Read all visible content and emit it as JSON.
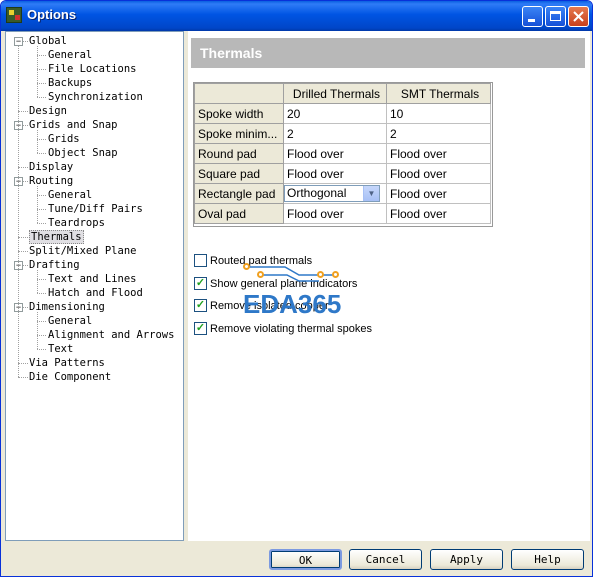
{
  "window": {
    "title": "Options",
    "app_icon_text": "PADS"
  },
  "tree": [
    {
      "label": "Global",
      "level": 0,
      "expandable": true
    },
    {
      "label": "General",
      "level": 1
    },
    {
      "label": "File Locations",
      "level": 1
    },
    {
      "label": "Backups",
      "level": 1
    },
    {
      "label": "Synchronization",
      "level": 1
    },
    {
      "label": "Design",
      "level": 0
    },
    {
      "label": "Grids and Snap",
      "level": 0,
      "expandable": true
    },
    {
      "label": "Grids",
      "level": 1
    },
    {
      "label": "Object Snap",
      "level": 1
    },
    {
      "label": "Display",
      "level": 0
    },
    {
      "label": "Routing",
      "level": 0,
      "expandable": true
    },
    {
      "label": "General",
      "level": 1
    },
    {
      "label": "Tune/Diff Pairs",
      "level": 1
    },
    {
      "label": "Teardrops",
      "level": 1
    },
    {
      "label": "Thermals",
      "level": 0,
      "selected": true
    },
    {
      "label": "Split/Mixed Plane",
      "level": 0
    },
    {
      "label": "Drafting",
      "level": 0,
      "expandable": true
    },
    {
      "label": "Text and Lines",
      "level": 1
    },
    {
      "label": "Hatch and Flood",
      "level": 1
    },
    {
      "label": "Dimensioning",
      "level": 0,
      "expandable": true
    },
    {
      "label": "General",
      "level": 1
    },
    {
      "label": "Alignment and Arrows",
      "level": 1
    },
    {
      "label": "Text",
      "level": 1
    },
    {
      "label": "Via Patterns",
      "level": 0
    },
    {
      "label": "Die Component",
      "level": 0
    }
  ],
  "page": {
    "header": "Thermals"
  },
  "grid": {
    "columns": [
      "",
      "Drilled Thermals",
      "SMT Thermals"
    ],
    "rows": [
      {
        "label": "Spoke width",
        "drilled": "20",
        "smt": "10"
      },
      {
        "label": "Spoke minim...",
        "drilled": "2",
        "smt": "2"
      },
      {
        "label": "Round pad",
        "drilled": "Flood over",
        "smt": "Flood over"
      },
      {
        "label": "Square pad",
        "drilled": "Flood over",
        "smt": "Flood over"
      },
      {
        "label": "Rectangle pad",
        "drilled": "Orthogonal",
        "smt": "Flood over"
      },
      {
        "label": "Oval pad",
        "drilled": "Flood over",
        "smt": "Flood over"
      }
    ]
  },
  "options": [
    {
      "label": "Routed pad thermals",
      "checked": false
    },
    {
      "label": "Show general plane indicators",
      "checked": true
    },
    {
      "label": "Remove isolated copper",
      "checked": true
    },
    {
      "label": "Remove violating thermal spokes",
      "checked": true
    }
  ],
  "watermark": {
    "text": "EDA365"
  },
  "buttons": {
    "ok": "OK",
    "cancel": "Cancel",
    "apply": "Apply",
    "help": "Help"
  },
  "colors": {
    "title_bar": "#0054e3",
    "header_bg": "#b8b8b8",
    "checkmark": "#21a121",
    "watermark": "#2e78c8"
  }
}
